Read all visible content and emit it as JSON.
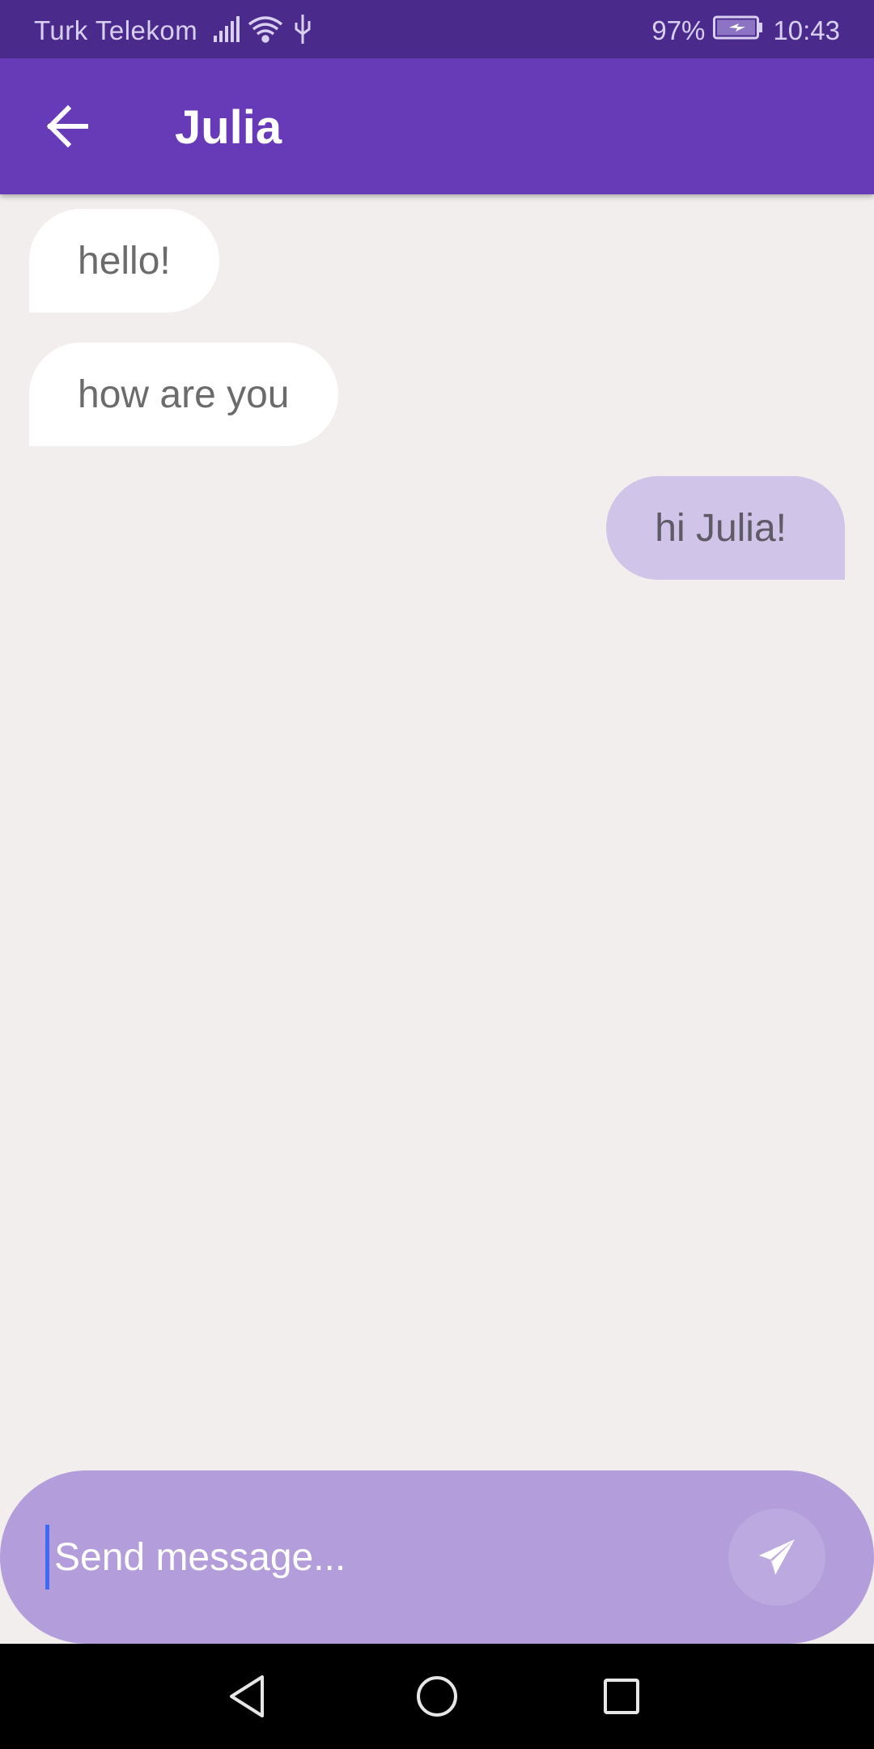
{
  "status_bar": {
    "carrier": "Turk Telekom",
    "battery_percent": "97%",
    "time": "10:43",
    "icons": [
      "signal-icon",
      "wifi-icon",
      "usb-icon",
      "battery-charging-icon"
    ]
  },
  "app_bar": {
    "title": "Julia",
    "back_icon": "arrow-left-icon"
  },
  "messages": [
    {
      "direction": "incoming",
      "text": "hello!"
    },
    {
      "direction": "incoming",
      "text": "how are you"
    },
    {
      "direction": "outgoing",
      "text": "hi Julia!"
    }
  ],
  "composer": {
    "placeholder": "Send message...",
    "value": "",
    "send_icon": "paper-plane-icon"
  },
  "nav_bar": {
    "icons": [
      "nav-back-icon",
      "nav-home-icon",
      "nav-recents-icon"
    ]
  },
  "colors": {
    "status_bar": "#4a2b8c",
    "app_bar": "#673ab7",
    "background": "#f2eeee",
    "incoming_bubble": "#ffffff",
    "outgoing_bubble": "#d1c4e9",
    "composer": "#b39ddb"
  }
}
